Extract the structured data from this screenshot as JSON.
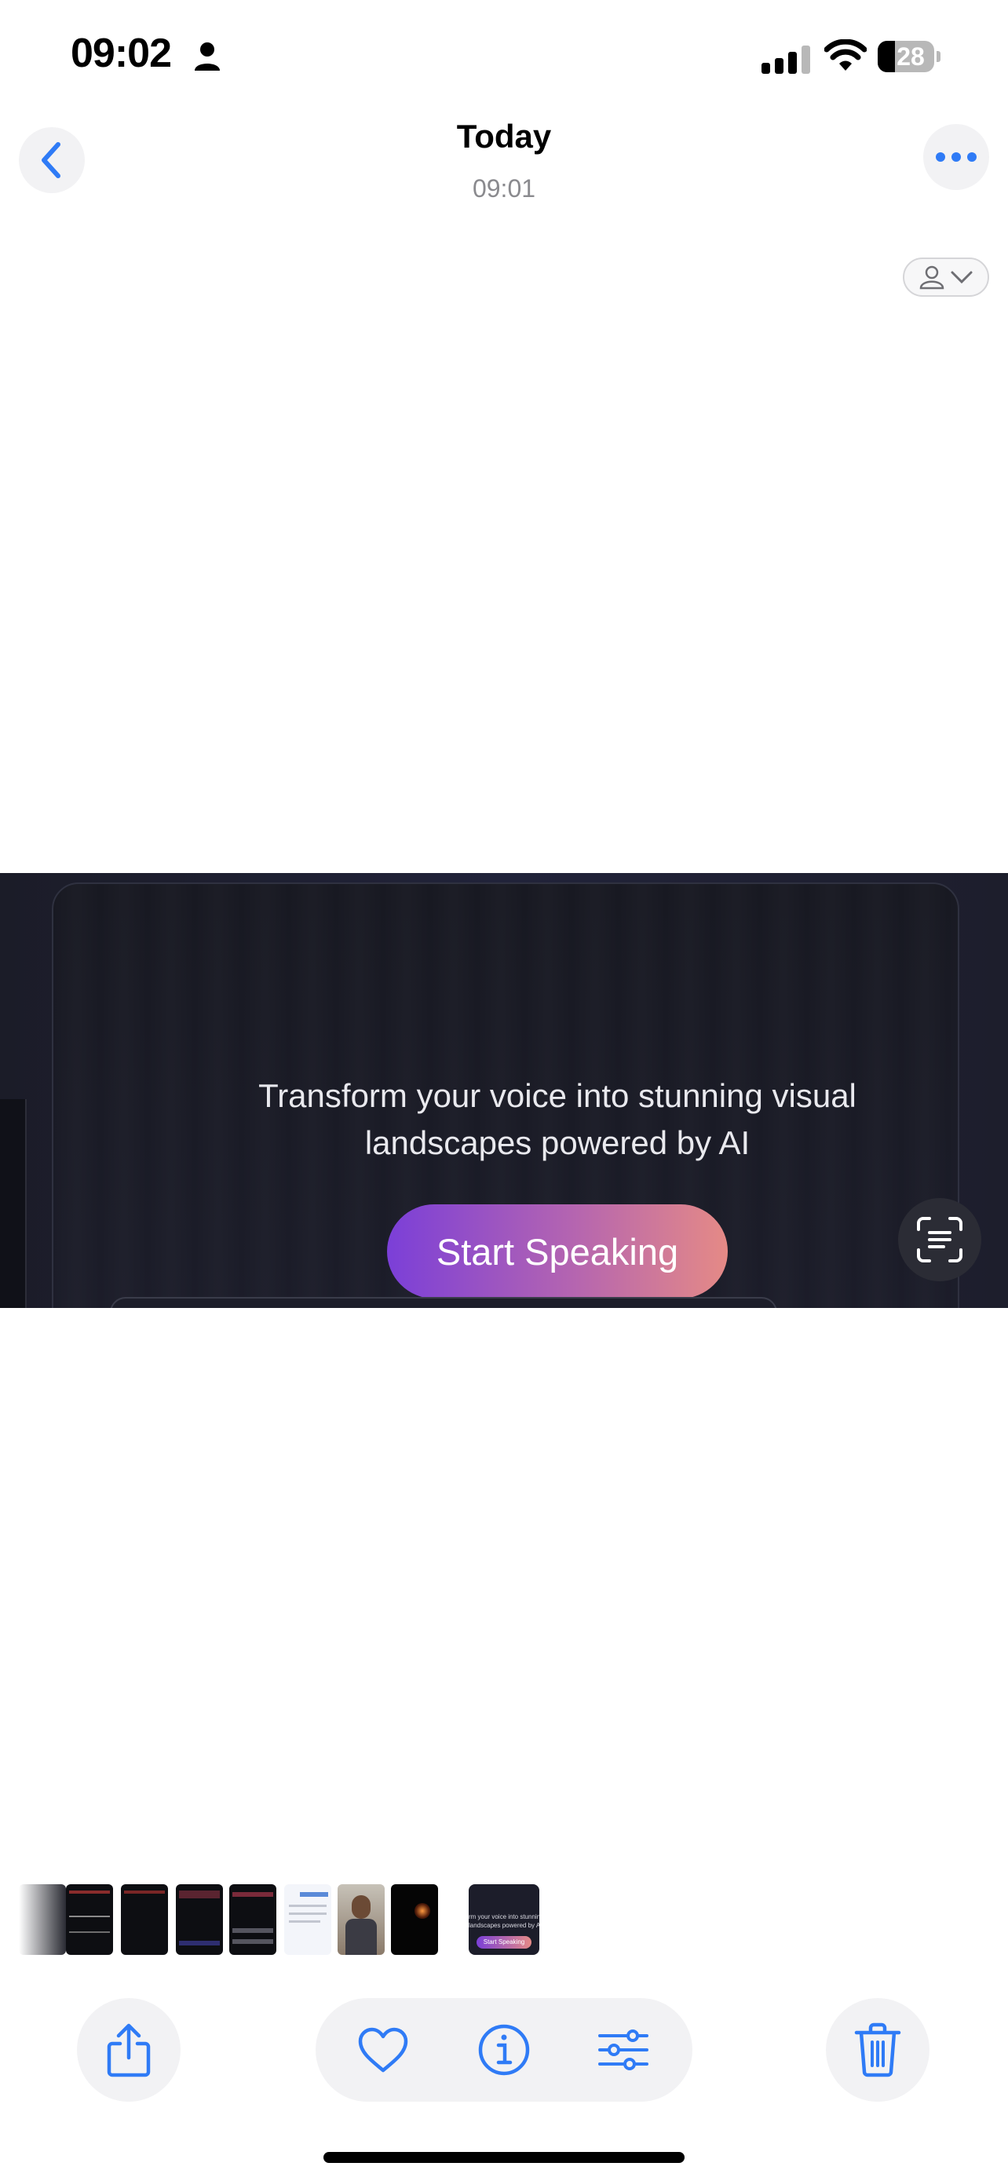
{
  "status_bar": {
    "time": "09:02",
    "battery": "28"
  },
  "nav": {
    "title": "Today",
    "subtitle": "09:01"
  },
  "photo": {
    "tagline_line1": "Transform your voice into stunning visual",
    "tagline_line2": "landscapes powered by AI",
    "button_label": "Start Speaking"
  },
  "thumbnails": {
    "current": {
      "line1": "rm your voice into stunning",
      "line2": "landscapes powered by AI",
      "button": "Start Speaking"
    }
  },
  "colors": {
    "accent": "#2f7bf6",
    "pill_bg": "#f2f2f4"
  },
  "icons": [
    "person-icon",
    "signal-icon",
    "wifi-icon",
    "battery-icon",
    "chevron-left-icon",
    "ellipsis-icon",
    "person-dropdown-icon",
    "live-text-icon",
    "share-icon",
    "heart-icon",
    "info-icon",
    "sliders-icon",
    "trash-icon"
  ]
}
